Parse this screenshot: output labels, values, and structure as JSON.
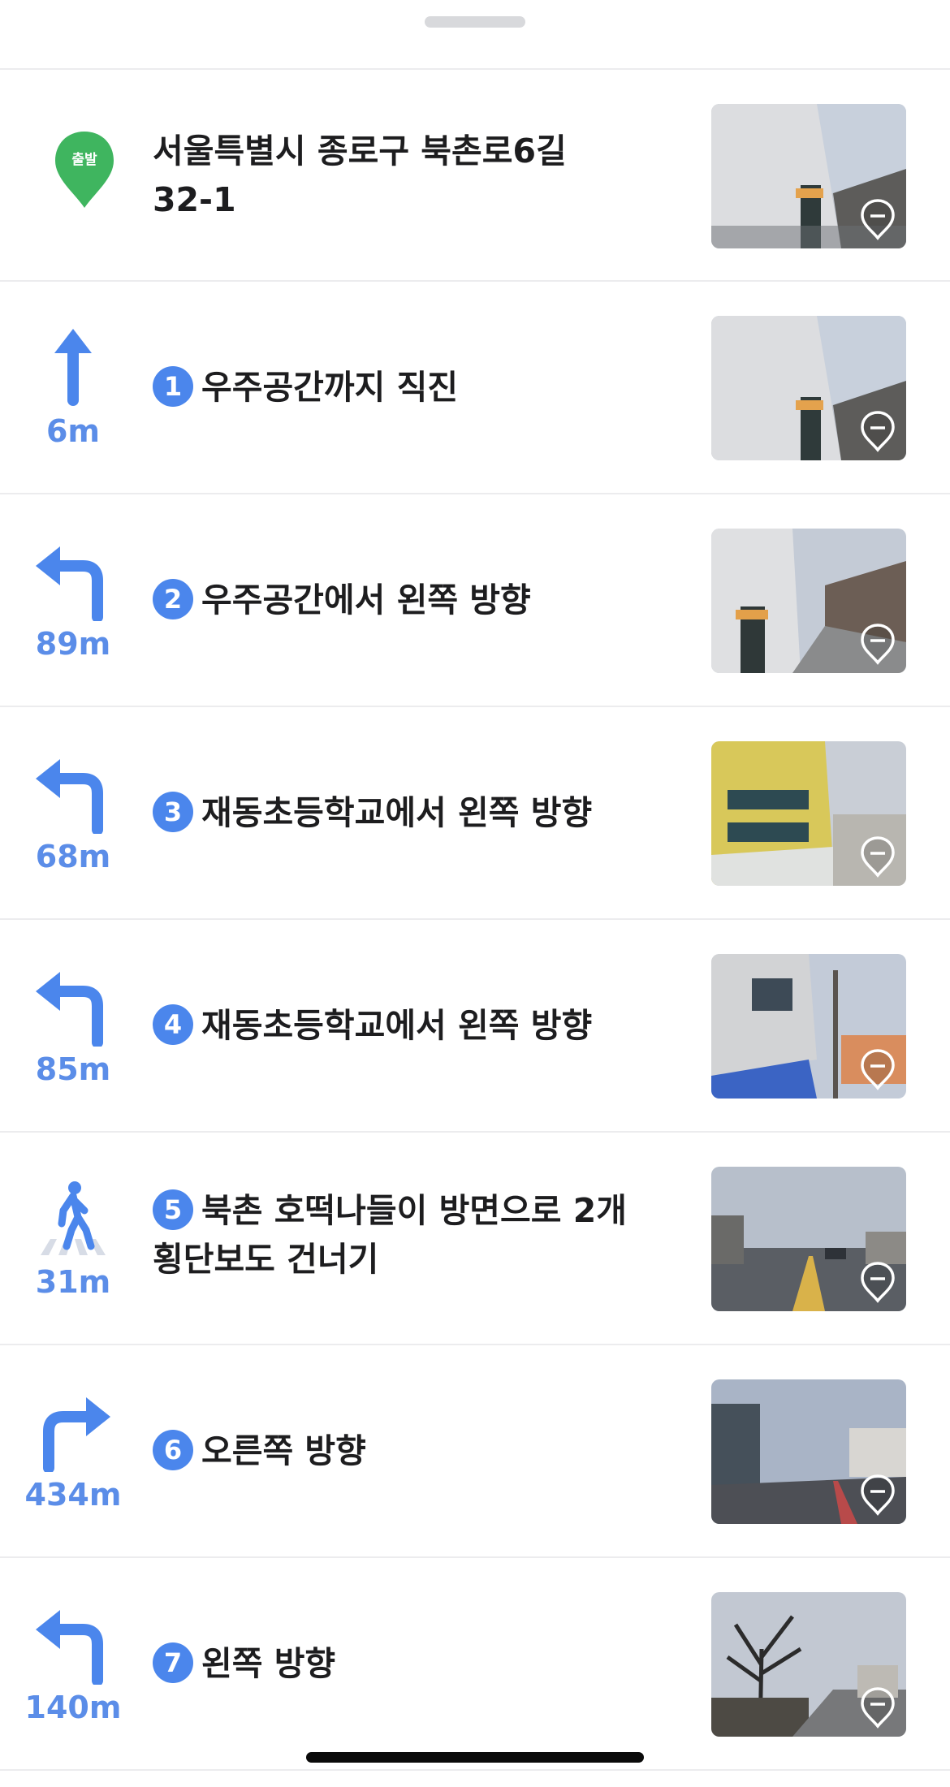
{
  "start": {
    "badge_label": "출발",
    "address_line1": "서울특별시 종로구 북촌로6길",
    "address_line2": "32-1"
  },
  "steps": [
    {
      "number": "1",
      "instruction": "우주공간까지 직진",
      "distance": "6m",
      "maneuver": "straight-arrow-icon"
    },
    {
      "number": "2",
      "instruction": "우주공간에서 왼쪽 방향",
      "distance": "89m",
      "maneuver": "turn-left-arrow-icon"
    },
    {
      "number": "3",
      "instruction": "재동초등학교에서 왼쪽 방향",
      "distance": "68m",
      "maneuver": "turn-left-arrow-icon"
    },
    {
      "number": "4",
      "instruction": "재동초등학교에서 왼쪽 방향",
      "distance": "85m",
      "maneuver": "turn-left-arrow-icon"
    },
    {
      "number": "5",
      "instruction_line1": "북촌 호떡나들이 방면으로 2개",
      "instruction_line2": "횡단보도 건너기",
      "distance": "31m",
      "maneuver": "crosswalk-pedestrian-icon"
    },
    {
      "number": "6",
      "instruction": "오른쪽 방향",
      "distance": "434m",
      "maneuver": "turn-right-arrow-icon"
    },
    {
      "number": "7",
      "instruction": "왼쪽 방향",
      "distance": "140m",
      "maneuver": "turn-left-arrow-icon"
    }
  ],
  "colors": {
    "accent_blue": "#4b86ec",
    "distance_blue": "#5b8de8",
    "start_pin_green": "#3fb55f",
    "text": "#1d1d1f",
    "divider": "#ececee"
  }
}
